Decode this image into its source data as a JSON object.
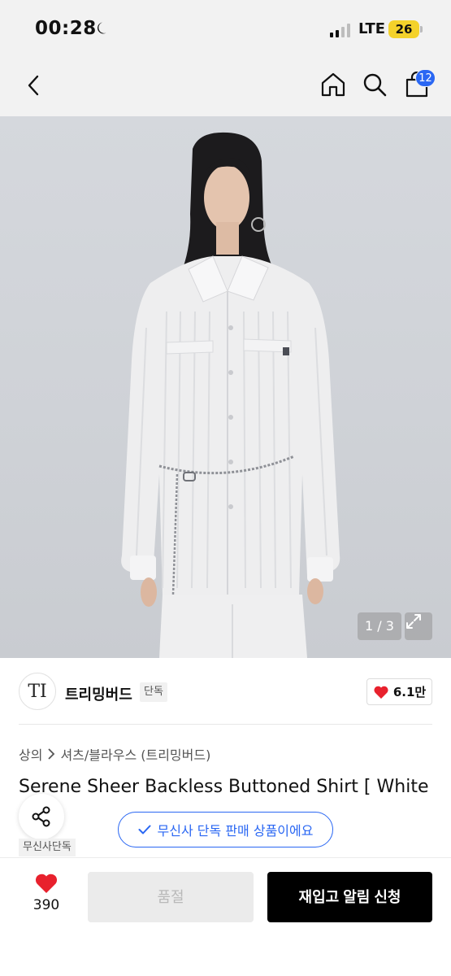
{
  "status_bar": {
    "time": "00:28",
    "network": "LTE",
    "battery": "26",
    "icons": [
      "moon-icon",
      "signal-icon",
      "battery-icon"
    ]
  },
  "nav": {
    "icons": [
      "chevron-left-icon",
      "home-icon",
      "search-icon",
      "shopping-bag-icon"
    ],
    "cart_count": "12"
  },
  "gallery": {
    "indicator": "1 / 3",
    "icons": [
      "expand-icon"
    ]
  },
  "brand": {
    "logo_text": "TI",
    "name": "트리밍버드",
    "tag": "단독",
    "like_count": "6.1만",
    "like_icon": "heart-icon",
    "like_color": "#e8212d"
  },
  "category": {
    "crumbs": [
      "상의",
      "셔츠/블라우스 (트리밍버드)"
    ]
  },
  "product": {
    "title": "Serene Sheer Backless Buttoned Shirt [ White",
    "exclusive_chip": "무신사단독",
    "exclusive_banner": "무신사 단독 판매 상품이에요",
    "accent_color": "#2a67f3"
  },
  "bottom_bar": {
    "wish_count": "390",
    "soldout_label": "품절",
    "restock_label": "재입고 알림 신청"
  }
}
